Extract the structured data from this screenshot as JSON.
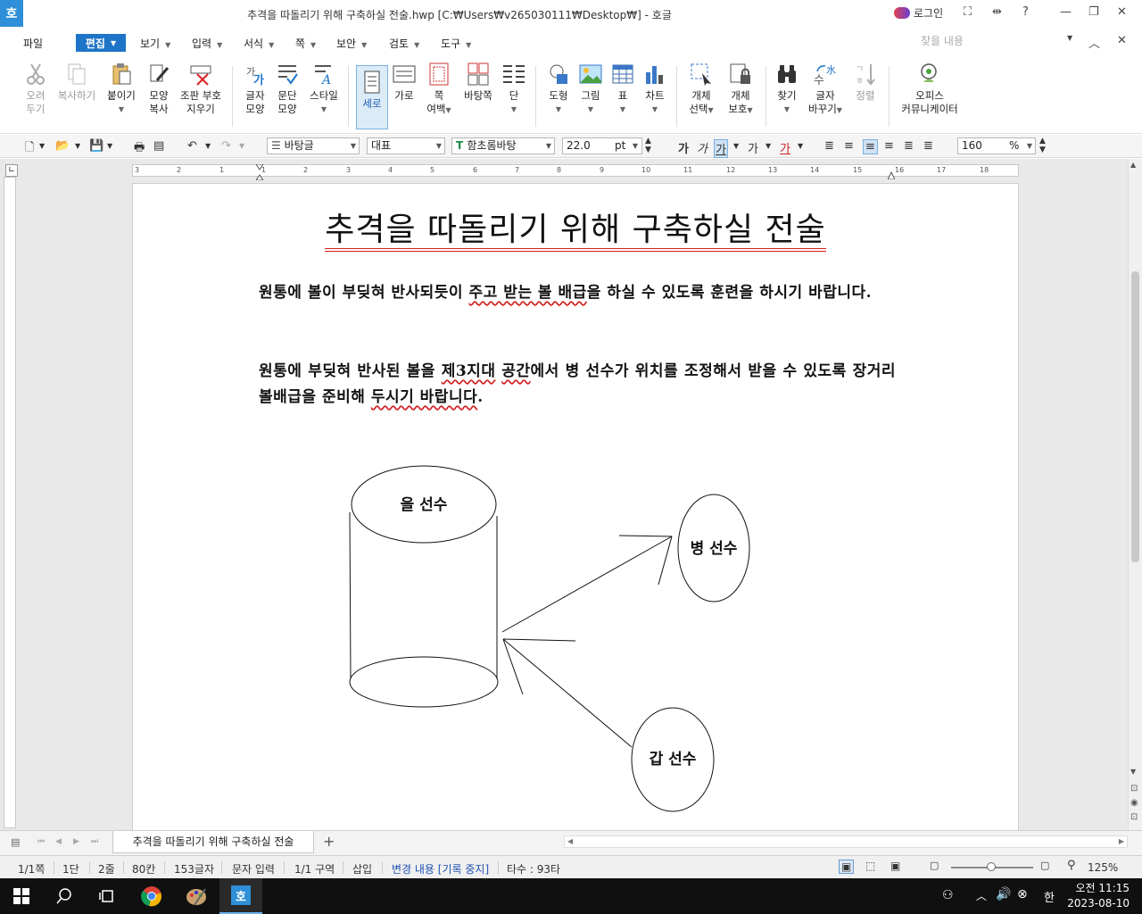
{
  "window": {
    "app_logo": "호",
    "title": "추격을 따돌리기 위해 구축하실 전술.hwp [C:₩Users₩v265030111₩Desktop₩] - 호글",
    "login_label": "로그인"
  },
  "menu": {
    "items": [
      "파일",
      "편집",
      "보기",
      "입력",
      "서식",
      "쪽",
      "보안",
      "검토",
      "도구"
    ],
    "search_placeholder": "찾을 내용"
  },
  "ribbon": {
    "cut": [
      "오려",
      "두기"
    ],
    "copy": "복사하기",
    "paste": "붙이기",
    "format_copy": [
      "모양",
      "복사"
    ],
    "control_mark": [
      "조판 부호",
      "지우기"
    ],
    "char_shape": [
      "글자",
      "모양"
    ],
    "para_shape": [
      "문단",
      "모양"
    ],
    "style": "스타일",
    "vertical": "세로",
    "horizontal": "가로",
    "margin": [
      "쪽",
      "여백"
    ],
    "background": "바탕쪽",
    "columns": "단",
    "shape": "도형",
    "picture": "그림",
    "table": "표",
    "chart": "차트",
    "select_object": [
      "개체",
      "선택"
    ],
    "protect_object": [
      "개체",
      "보호"
    ],
    "find": "찾기",
    "replace": [
      "글자",
      "바꾸기"
    ],
    "sort": "정렬",
    "office": [
      "오피스",
      "커뮤니케이터"
    ]
  },
  "format": {
    "style": "바탕글",
    "lang": "대표",
    "font": "함초롬바탕",
    "size": "22.0",
    "unit": "pt",
    "zoom": "160",
    "zoom_unit": "%"
  },
  "ruler": {
    "ticks": [
      "3",
      "2",
      "1",
      "1",
      "2",
      "3",
      "4",
      "5",
      "6",
      "7",
      "8",
      "9",
      "10",
      "11",
      "12",
      "13",
      "14",
      "15",
      "16",
      "17",
      "18"
    ]
  },
  "document": {
    "title": "추격을 따돌리기 위해 구축하실 전술",
    "para1_a": "원통에 볼이 부딪혀 반사되듯이 ",
    "para1_b": "주고 받는 볼 배급",
    "para1_c": "을 하실 수 있도록 훈련을 하시기 바랍니다.",
    "para2_a": "원통에 부딪혀 반사된 볼을 ",
    "para2_b": "제3지대",
    "para2_c": " ",
    "para2_d": "공간",
    "para2_e": "에서 병 선수가 위치를 조정해서 받을 수 있도록 장거리 볼배급을 준비해 ",
    "para2_f": "두시기 바랍니다",
    "para2_g": ".",
    "diagram": {
      "cylinder_label": "을 선수",
      "player_b": "병 선수",
      "player_a": "갑 선수"
    }
  },
  "tabs": {
    "doc_tab": "추격을 따돌리기 위해 구축하실 전술",
    "add": "+"
  },
  "status": {
    "page": "1/1쪽",
    "column": "1단",
    "line": "2줄",
    "col": "80칸",
    "chars": "153글자",
    "mode": "문자 입력",
    "section": "1/1 구역",
    "insert": "삽입",
    "track": "변경 내용 [기록 중지]",
    "typing": "타수 : 93타",
    "zoom": "125%"
  },
  "taskbar": {
    "time": "오전 11:15",
    "date": "2023-08-10",
    "ime": "한"
  },
  "colors": {
    "accent": "#1e74c7",
    "title_underline": "#d32020"
  }
}
